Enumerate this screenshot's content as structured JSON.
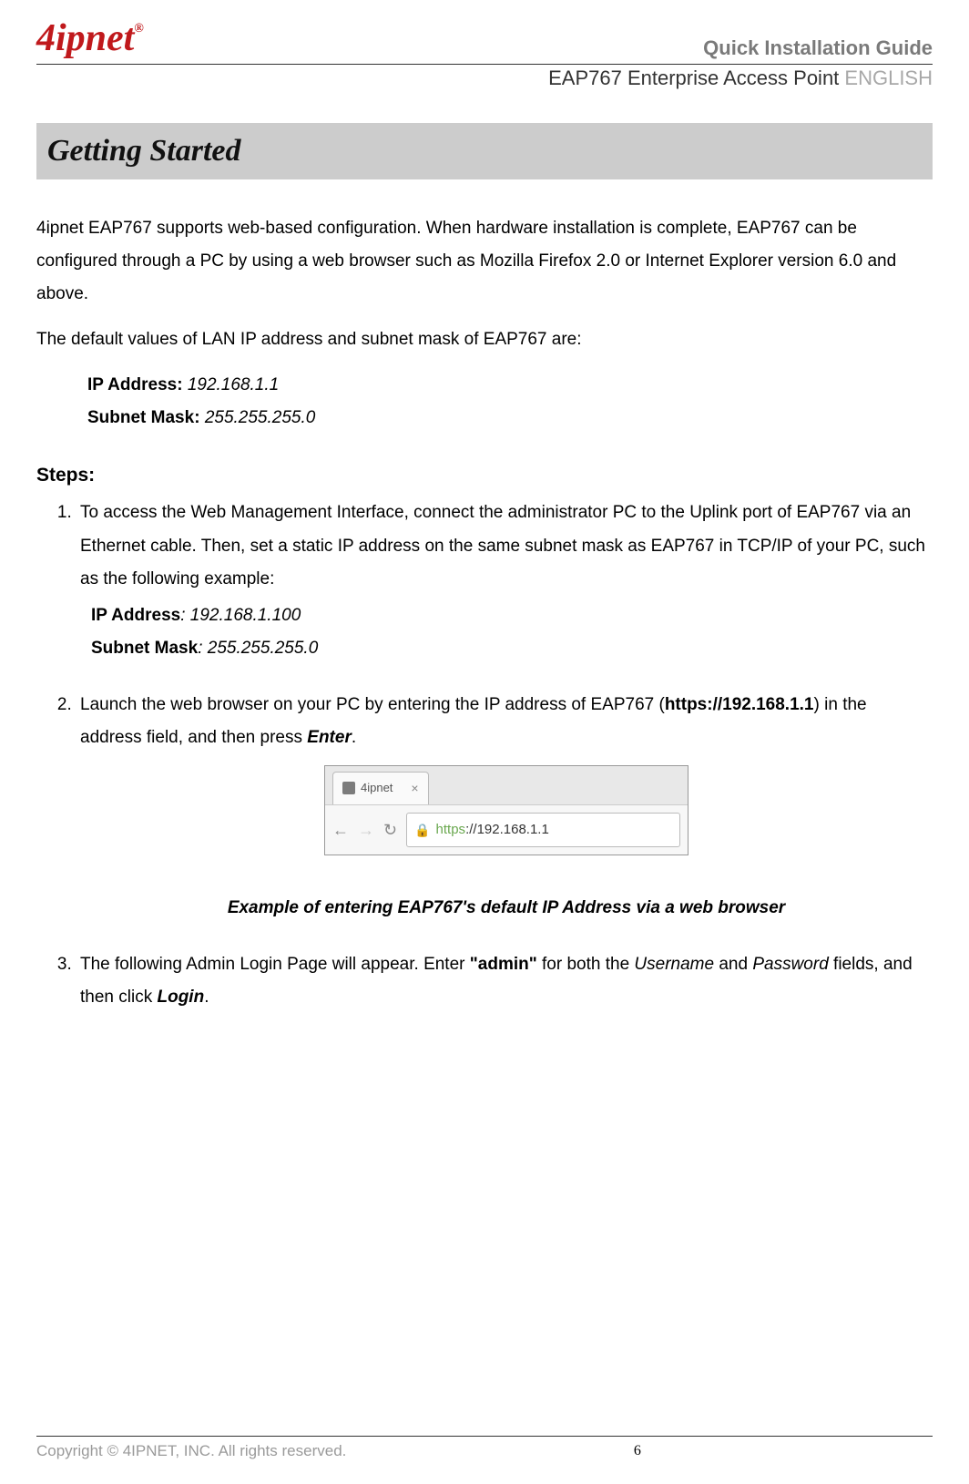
{
  "header": {
    "logo_text": "4ipnet",
    "logo_sup": "®",
    "guide_title": "Quick Installation Guide",
    "product_name": "EAP767 Enterprise Access Point",
    "language": " ENGLISH"
  },
  "section_title": "Getting Started",
  "intro_para": "4ipnet EAP767 supports web-based configuration. When hardware installation is complete, EAP767 can be configured through a PC by using a web browser such as Mozilla Firefox 2.0 or Internet Explorer version 6.0 and above.",
  "defaults_intro": "The default values of LAN IP address and subnet mask of EAP767 are:",
  "defaults": {
    "ip_label": "IP Address: ",
    "ip_value": "192.168.1.1",
    "mask_label": "Subnet Mask: ",
    "mask_value": "255.255.255.0"
  },
  "steps_heading": "Steps:",
  "step1": {
    "text": "To access the Web Management Interface, connect the administrator PC to the Uplink port of EAP767 via an Ethernet cable. Then, set a static IP address on the same subnet mask as EAP767 in TCP/IP of your PC, such as the following example:",
    "ip_label": "IP Address",
    "ip_value": ": 192.168.1.100",
    "mask_label": "Subnet Mask",
    "mask_value": ": 255.255.255.0"
  },
  "step2": {
    "pre": "Launch the web browser on your PC by entering the IP address of EAP767 (",
    "url_bold": "https://192.168.1.1",
    "mid": ") in the address field, and then press ",
    "enter": "Enter",
    "post": "."
  },
  "browser": {
    "tab_label": "4ipnet",
    "tab_close": "×",
    "back_glyph": "←",
    "fwd_glyph": "→",
    "reload_glyph": "↻",
    "lock_glyph": "🔒",
    "scheme": "https",
    "rest": "://192.168.1.1"
  },
  "caption": "Example of entering EAP767's default IP Address via a web browser",
  "step3": {
    "pre": "The following Admin Login Page will appear. Enter ",
    "admin": "\"admin\"",
    "mid1": " for both the ",
    "username": "Username",
    "and": " and ",
    "password": "Password",
    "mid2": " fields, and then click ",
    "login": "Login",
    "post": "."
  },
  "footer": {
    "copyright": "Copyright © 4IPNET, INC. All rights reserved.",
    "page_no": "6"
  }
}
